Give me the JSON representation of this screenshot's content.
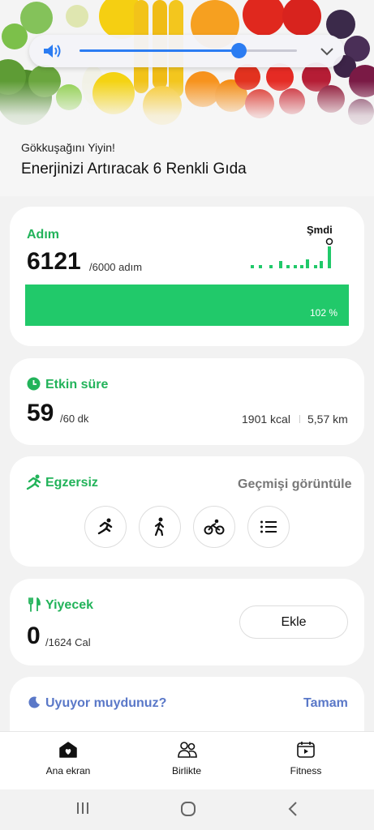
{
  "banner": {
    "subtitle": "Gökkuşağını Yiyin!",
    "title": "Enerjinizi Artıracak 6 Renkli Gıda"
  },
  "volume": {
    "level": 0.73,
    "icon": "speaker-icon",
    "expand_icon": "chevron-down-icon",
    "accent": "#2b7cf2"
  },
  "steps": {
    "label": "Adım",
    "value": "6121",
    "goal": "/6000 adım",
    "now_label": "Şmdi",
    "progress_label": "102 %",
    "progress": 1.02,
    "accent": "#21c96a"
  },
  "active_time": {
    "label": "Etkin süre",
    "value": "59",
    "goal": "/60 dk",
    "kcal": "1901 kcal",
    "distance": "5,57 km",
    "icon": "clock-icon"
  },
  "exercise": {
    "label": "Egzersiz",
    "history_link": "Geçmişi görüntüle",
    "icon": "running-icon",
    "buttons": [
      "running-icon",
      "walking-icon",
      "cycling-icon",
      "list-icon"
    ]
  },
  "food": {
    "label": "Yiyecek",
    "value": "0",
    "goal": "/1624 Cal",
    "add_button": "Ekle",
    "icon": "fork-knife-icon"
  },
  "sleep": {
    "label": "Uyuyor muydunuz?",
    "action": "Tamam",
    "icon": "moon-icon",
    "accent": "#5a78c8"
  },
  "nav": {
    "items": [
      {
        "label": "Ana ekran",
        "icon": "home-icon"
      },
      {
        "label": "Birlikte",
        "icon": "people-icon"
      },
      {
        "label": "Fitness",
        "icon": "fitness-icon"
      }
    ]
  },
  "system_nav": [
    "recents-icon",
    "home-circle-icon",
    "back-icon"
  ]
}
